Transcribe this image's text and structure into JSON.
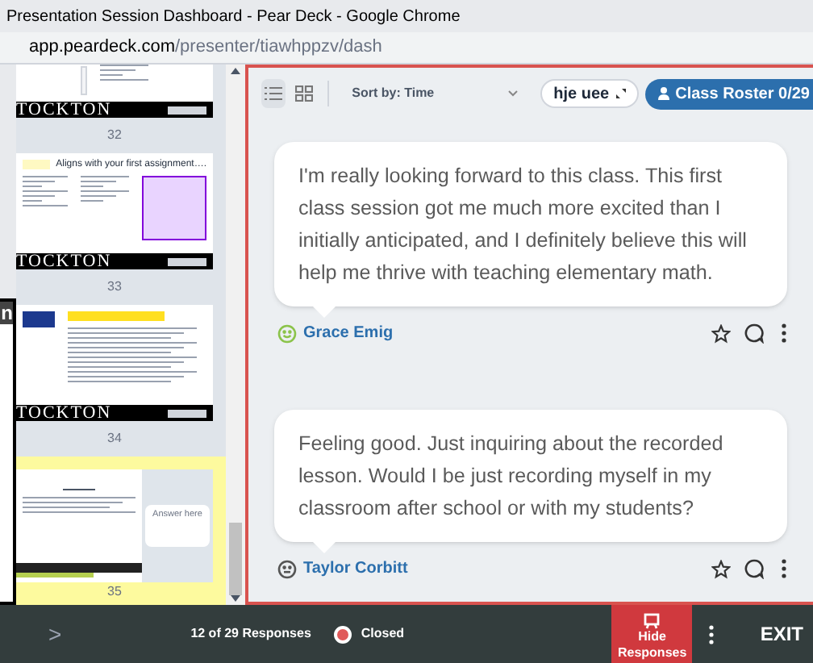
{
  "window": {
    "title": "Presentation Session Dashboard - Pear Deck - Google Chrome"
  },
  "address_bar": {
    "domain": "app.peardeck.com",
    "path": "/presenter/tiawhppzv/dash"
  },
  "left_edge_panel": {
    "text": "n"
  },
  "thumbnails": [
    {
      "number": "32",
      "selected": false,
      "kind": "plain",
      "band_text": "TOCKTON"
    },
    {
      "number": "33",
      "selected": false,
      "kind": "titled",
      "title": "Aligns with your first assignment….",
      "band_text": "TOCKTON"
    },
    {
      "number": "34",
      "selected": false,
      "kind": "document",
      "band_text": "TOCKTON"
    },
    {
      "number": "35",
      "selected": true,
      "kind": "question",
      "answer_text": "Answer here"
    }
  ],
  "toolbar": {
    "views": [
      {
        "kind": "list",
        "selected": true
      },
      {
        "kind": "grid",
        "selected": false
      }
    ],
    "sort": "Sort by: Time",
    "join_code": "hje uee",
    "roster_button": "Class Roster 0/29"
  },
  "responses": [
    {
      "text": "I'm really looking forward to this class. This first class session got me much more excited than I initially anticipated, and I definitely believe this will help me thrive with teaching elementary math.",
      "student": "Grace Emig",
      "kind": "happy",
      "color": "#8bc34a"
    },
    {
      "text": "Feeling good. Just inquiring about the recorded lesson. Would I be just recording myself in my classroom after school or with my students?",
      "student": "Taylor Corbitt",
      "kind": "neutral",
      "color": "#555555"
    }
  ],
  "bottom_bar": {
    "next": ">",
    "count": "12 of 29 Responses",
    "status": {
      "label": "Closed",
      "color": "#e05a5a"
    },
    "hide_button": "Hide Responses",
    "exit": "EXIT"
  }
}
